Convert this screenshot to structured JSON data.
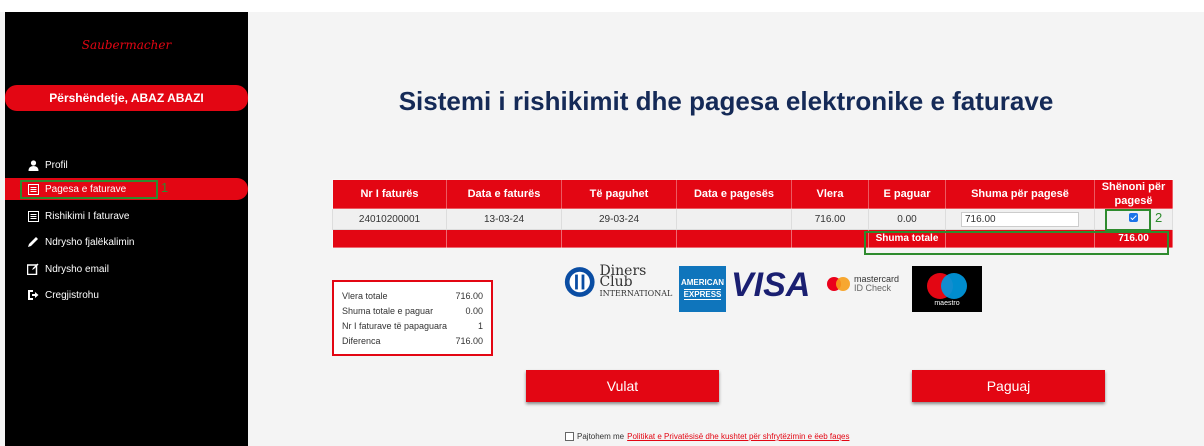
{
  "sidebar": {
    "logo_text": "Saubermacher",
    "greeting": "Përshëndetje, ABAZ ABAZI",
    "items": [
      {
        "label": "Profil",
        "icon": "user-icon",
        "active": false
      },
      {
        "label": "Pagesa e faturave",
        "icon": "invoice-icon",
        "active": true
      },
      {
        "label": "Rishikimi I faturave",
        "icon": "list-icon",
        "active": false
      },
      {
        "label": "Ndrysho fjalëkalimin",
        "icon": "pencil-icon",
        "active": false
      },
      {
        "label": "Ndrysho email",
        "icon": "edit-icon",
        "active": false
      },
      {
        "label": "Cregjistrohu",
        "icon": "logout-icon",
        "active": false
      }
    ]
  },
  "annotations": {
    "step1": "1",
    "step2": "2"
  },
  "main": {
    "title": "Sistemi i rishikimit dhe pagesa elektronike e faturave"
  },
  "invoice_table": {
    "headers": [
      "Nr I faturës",
      "Data e faturës",
      "Të paguhet",
      "Data e pagesës",
      "Vlera",
      "E paguar",
      "Shuma për pagesë",
      "Shënoni për pagesë"
    ],
    "rows": [
      {
        "nr": "24010200001",
        "data_fatures": "13-03-24",
        "te_paguhet": "29-03-24",
        "data_pageses": "",
        "vlera": "716.00",
        "e_paguar": "0.00",
        "shuma": "716.00",
        "checked": true
      }
    ],
    "total_label": "Shuma totale",
    "total_value": "716.00"
  },
  "summary": {
    "rows": [
      {
        "label": "Vlera totale",
        "value": "716.00"
      },
      {
        "label": "Shuma totale e paguar",
        "value": "0.00"
      },
      {
        "label": "Nr I faturave të papaguara",
        "value": "1"
      },
      {
        "label": "Diferenca",
        "value": "716.00"
      }
    ]
  },
  "payment_logos": {
    "diners_line1": "Diners Club",
    "diners_line2": "INTERNATIONAL",
    "amex_line1": "AMERICAN",
    "amex_line2": "EXPRESS",
    "visa": "VISA",
    "mastercard_line1": "mastercard",
    "mastercard_line2": "ID Check",
    "maestro": "maestro"
  },
  "buttons": {
    "cancel": "Vulat",
    "pay": "Paguaj"
  },
  "terms": {
    "prefix": "Pajtohem me",
    "link": "Politikat e Privatësisë dhe kushtet për shfrytëzimin e ëeb faqes"
  },
  "colors": {
    "brand_red": "#e30613",
    "title_navy": "#152a57",
    "annotation_green": "#2e8b2e"
  }
}
